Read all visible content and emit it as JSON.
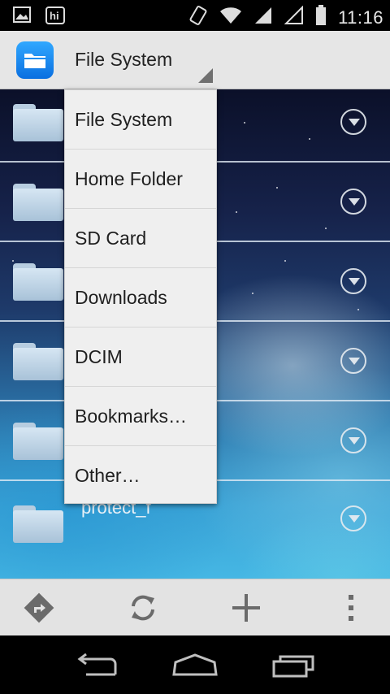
{
  "status_bar": {
    "time": "11:16",
    "left_icons": [
      "image-notification-icon",
      "hi-app-notification-icon"
    ],
    "right_icons": [
      "vibrate-icon",
      "wifi-icon",
      "signal-icon",
      "signal-empty-icon",
      "battery-icon"
    ]
  },
  "action_bar": {
    "title": "File System",
    "app_icon": "folder-app-icon"
  },
  "file_list": {
    "rows": [
      {
        "name": ""
      },
      {
        "name": ""
      },
      {
        "name": ""
      },
      {
        "name": ""
      },
      {
        "name": ""
      },
      {
        "name": "protect_f"
      }
    ]
  },
  "dropdown": {
    "items": [
      {
        "label": "File System"
      },
      {
        "label": "Home Folder"
      },
      {
        "label": "SD Card"
      },
      {
        "label": "Downloads"
      },
      {
        "label": "DCIM"
      },
      {
        "label": "Bookmarks…"
      },
      {
        "label": "Other…"
      }
    ]
  },
  "toolbar": {
    "buttons": [
      "directions-icon",
      "refresh-icon",
      "add-icon",
      "overflow-menu-icon"
    ]
  },
  "nav_bar": {
    "buttons": [
      "back-icon",
      "home-icon",
      "recents-icon"
    ]
  },
  "colors": {
    "action_bar_bg": "#e6e6e6",
    "dropdown_bg": "#efefef",
    "app_icon_blue": "#1a8cf0",
    "toolbar_bg": "#e3e3e3"
  }
}
